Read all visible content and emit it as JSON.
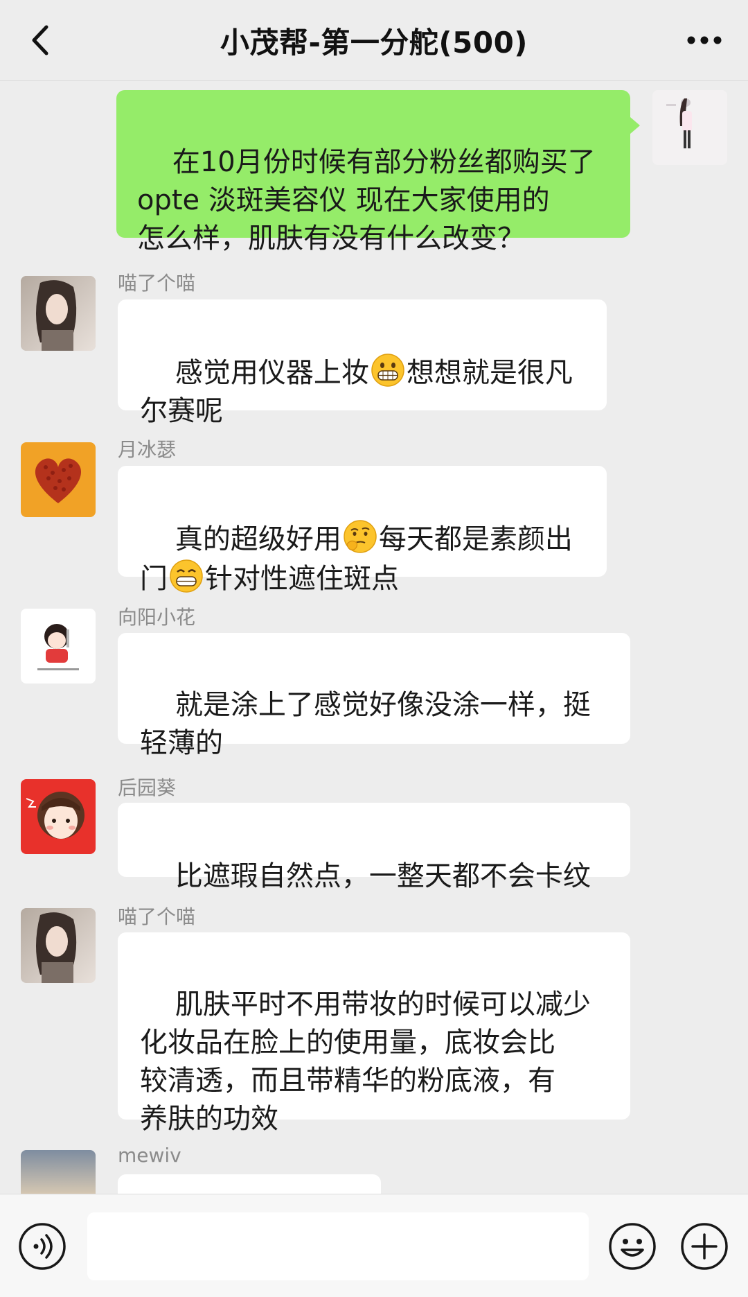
{
  "header": {
    "title": "小茂帮-第一分舵(500)"
  },
  "messages": [
    {
      "sender": "",
      "from_me": true,
      "text": "在10月份时候有部分粉丝都购买了\nopte 淡斑美容仪 现在大家使用的\n怎么样，肌肤有没有什么改变？"
    },
    {
      "sender": "喵了个喵",
      "text_a": "感觉用仪器上妆",
      "text_b": "想想就是很凡\n尔赛呢",
      "emoji": "grin-emoji"
    },
    {
      "sender": "月冰瑟",
      "text_a": "真的超级好用",
      "text_b": "每天都是素颜出\n门",
      "text_c": "针对性遮住斑点",
      "emoji_1": "thinking-emoji",
      "emoji_2": "grin-emoji"
    },
    {
      "sender": "向阳小花",
      "text": "就是涂上了感觉好像没涂一样，挺\n轻薄的"
    },
    {
      "sender": "后园葵",
      "text": "比遮瑕自然点，一整天都不会卡纹"
    },
    {
      "sender": "喵了个喵",
      "text": "肌肤平时不用带妆的时候可以减少\n化妆品在脸上的使用量，底妆会比\n较清透，而且带精华的粉底液，有\n养肤的功效"
    },
    {
      "sender": "mewiv",
      "text": ""
    }
  ],
  "input_bar": {
    "placeholder": ""
  },
  "colors": {
    "background": "#ededed",
    "my_bubble": "#95ec69",
    "other_bubble": "#ffffff"
  }
}
